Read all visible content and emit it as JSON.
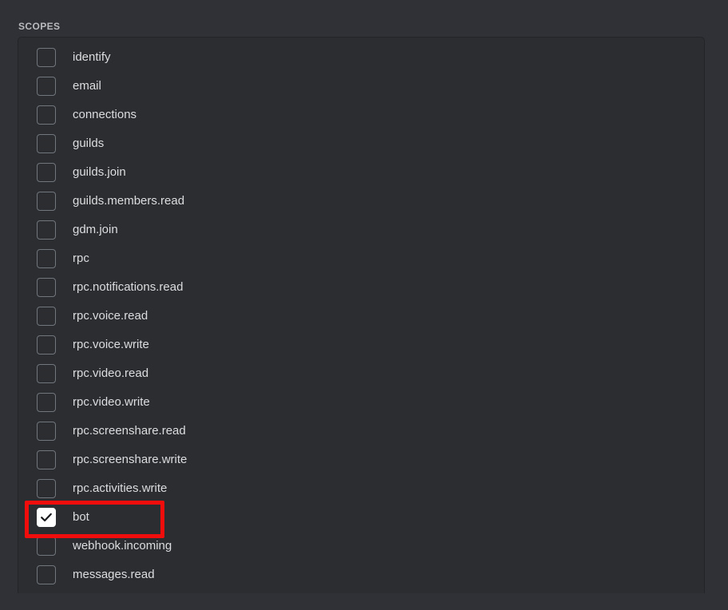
{
  "section": {
    "label": "SCOPES"
  },
  "colors": {
    "page_background": "#2f3136",
    "panel_background": "#2b2d31",
    "panel_border": "#222428",
    "label_text": "#b9bbbe",
    "scope_text": "#dcddde",
    "checkbox_border": "#72767d",
    "checkbox_checked_fill": "#ffffff",
    "checkmark": "#1a1b1e",
    "highlight_outline": "#f20d0d"
  },
  "scopes": [
    {
      "label": "identify",
      "checked": false
    },
    {
      "label": "email",
      "checked": false
    },
    {
      "label": "connections",
      "checked": false
    },
    {
      "label": "guilds",
      "checked": false
    },
    {
      "label": "guilds.join",
      "checked": false
    },
    {
      "label": "guilds.members.read",
      "checked": false
    },
    {
      "label": "gdm.join",
      "checked": false
    },
    {
      "label": "rpc",
      "checked": false
    },
    {
      "label": "rpc.notifications.read",
      "checked": false
    },
    {
      "label": "rpc.voice.read",
      "checked": false
    },
    {
      "label": "rpc.voice.write",
      "checked": false
    },
    {
      "label": "rpc.video.read",
      "checked": false
    },
    {
      "label": "rpc.video.write",
      "checked": false
    },
    {
      "label": "rpc.screenshare.read",
      "checked": false
    },
    {
      "label": "rpc.screenshare.write",
      "checked": false
    },
    {
      "label": "rpc.activities.write",
      "checked": false
    },
    {
      "label": "bot",
      "checked": true
    },
    {
      "label": "webhook.incoming",
      "checked": false
    },
    {
      "label": "messages.read",
      "checked": false
    }
  ],
  "annotation": {
    "target_scope": "bot",
    "shape": "rectangle-outline"
  }
}
